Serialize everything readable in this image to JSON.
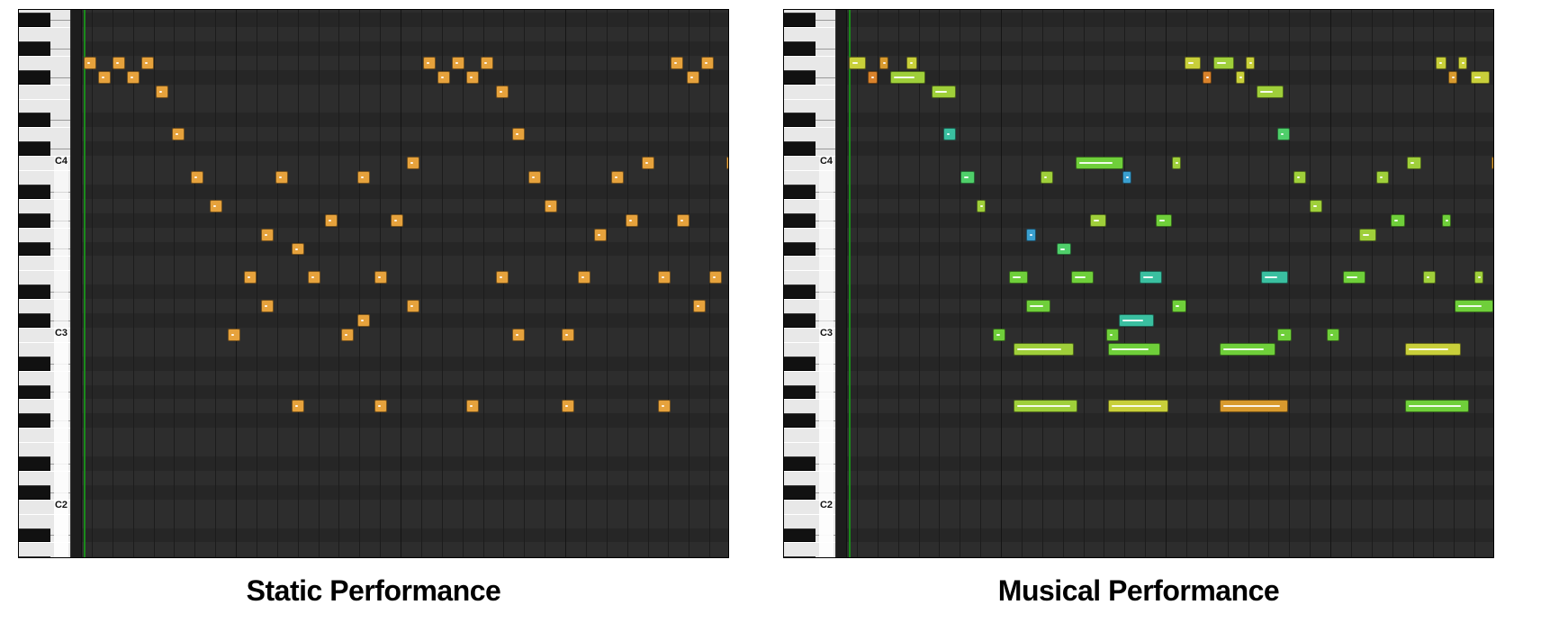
{
  "captions": {
    "left": "Static Performance",
    "right": "Musical Performance"
  },
  "keyLabels": {
    "C2": "C2",
    "C3": "C3",
    "C4": "C4"
  },
  "grid": {
    "rowHeight": 15.9,
    "topPitch": 70.2,
    "cols": 32,
    "playheadX": 14,
    "palette": {
      "0": "#e6a23c",
      "1": "#d9822b",
      "2": "#c8cf3a",
      "3": "#9fcf3a",
      "4": "#6fcf3a",
      "5": "#4fcf6a",
      "6": "#3abfa0",
      "7": "#3a9fcf",
      "8": "#d89a2e"
    }
  },
  "panels": [
    {
      "id": "static",
      "notes": [
        {
          "p": 67,
          "s": 0.0,
          "d": 0.7,
          "c": 0,
          "v": 0.3
        },
        {
          "p": 66,
          "s": 0.7,
          "d": 0.7,
          "c": 0,
          "v": 0.3
        },
        {
          "p": 67,
          "s": 1.4,
          "d": 0.7,
          "c": 0,
          "v": 0.3
        },
        {
          "p": 66,
          "s": 2.1,
          "d": 0.7,
          "c": 0,
          "v": 0.3
        },
        {
          "p": 67,
          "s": 2.8,
          "d": 0.7,
          "c": 0,
          "v": 0.3
        },
        {
          "p": 65,
          "s": 3.5,
          "d": 0.7,
          "c": 0,
          "v": 0.3
        },
        {
          "p": 62,
          "s": 4.3,
          "d": 0.7,
          "c": 0,
          "v": 0.3
        },
        {
          "p": 59,
          "s": 5.2,
          "d": 0.7,
          "c": 0,
          "v": 0.3
        },
        {
          "p": 57,
          "s": 6.1,
          "d": 0.7,
          "c": 0,
          "v": 0.3
        },
        {
          "p": 48,
          "s": 7.0,
          "d": 0.7,
          "c": 0,
          "v": 0.3
        },
        {
          "p": 52,
          "s": 7.8,
          "d": 0.7,
          "c": 0,
          "v": 0.3
        },
        {
          "p": 50,
          "s": 8.6,
          "d": 0.7,
          "c": 0,
          "v": 0.3
        },
        {
          "p": 55,
          "s": 8.6,
          "d": 0.7,
          "c": 0,
          "v": 0.3
        },
        {
          "p": 59,
          "s": 9.3,
          "d": 0.7,
          "c": 0,
          "v": 0.3
        },
        {
          "p": 54,
          "s": 10.1,
          "d": 0.7,
          "c": 0,
          "v": 0.3
        },
        {
          "p": 43,
          "s": 10.1,
          "d": 0.7,
          "c": 0,
          "v": 0.3
        },
        {
          "p": 52,
          "s": 10.9,
          "d": 0.7,
          "c": 0,
          "v": 0.3
        },
        {
          "p": 56,
          "s": 11.7,
          "d": 0.7,
          "c": 0,
          "v": 0.3
        },
        {
          "p": 48,
          "s": 12.5,
          "d": 0.7,
          "c": 0,
          "v": 0.3
        },
        {
          "p": 49,
          "s": 13.3,
          "d": 0.7,
          "c": 0,
          "v": 0.3
        },
        {
          "p": 59,
          "s": 13.3,
          "d": 0.7,
          "c": 0,
          "v": 0.3
        },
        {
          "p": 52,
          "s": 14.1,
          "d": 0.7,
          "c": 0,
          "v": 0.3
        },
        {
          "p": 43,
          "s": 14.1,
          "d": 0.7,
          "c": 0,
          "v": 0.3
        },
        {
          "p": 56,
          "s": 14.9,
          "d": 0.7,
          "c": 0,
          "v": 0.3
        },
        {
          "p": 50,
          "s": 15.7,
          "d": 0.7,
          "c": 0,
          "v": 0.3
        },
        {
          "p": 60,
          "s": 15.7,
          "d": 0.7,
          "c": 0,
          "v": 0.3
        },
        {
          "p": 67,
          "s": 16.5,
          "d": 0.7,
          "c": 0,
          "v": 0.3
        },
        {
          "p": 66,
          "s": 17.2,
          "d": 0.7,
          "c": 0,
          "v": 0.3
        },
        {
          "p": 67,
          "s": 17.9,
          "d": 0.7,
          "c": 0,
          "v": 0.3
        },
        {
          "p": 66,
          "s": 18.6,
          "d": 0.7,
          "c": 0,
          "v": 0.3
        },
        {
          "p": 67,
          "s": 19.3,
          "d": 0.7,
          "c": 0,
          "v": 0.3
        },
        {
          "p": 65,
          "s": 20.0,
          "d": 0.7,
          "c": 0,
          "v": 0.3
        },
        {
          "p": 43,
          "s": 18.6,
          "d": 0.7,
          "c": 0,
          "v": 0.3
        },
        {
          "p": 62,
          "s": 20.8,
          "d": 0.7,
          "c": 0,
          "v": 0.3
        },
        {
          "p": 52,
          "s": 20.0,
          "d": 0.7,
          "c": 0,
          "v": 0.3
        },
        {
          "p": 48,
          "s": 20.8,
          "d": 0.7,
          "c": 0,
          "v": 0.3
        },
        {
          "p": 59,
          "s": 21.6,
          "d": 0.7,
          "c": 0,
          "v": 0.3
        },
        {
          "p": 57,
          "s": 22.4,
          "d": 0.7,
          "c": 0,
          "v": 0.3
        },
        {
          "p": 48,
          "s": 23.2,
          "d": 0.7,
          "c": 0,
          "v": 0.3
        },
        {
          "p": 43,
          "s": 23.2,
          "d": 0.7,
          "c": 0,
          "v": 0.3
        },
        {
          "p": 52,
          "s": 24.0,
          "d": 0.7,
          "c": 0,
          "v": 0.3
        },
        {
          "p": 55,
          "s": 24.8,
          "d": 0.7,
          "c": 0,
          "v": 0.3
        },
        {
          "p": 59,
          "s": 25.6,
          "d": 0.7,
          "c": 0,
          "v": 0.3
        },
        {
          "p": 56,
          "s": 26.3,
          "d": 0.7,
          "c": 0,
          "v": 0.3
        },
        {
          "p": 60,
          "s": 27.1,
          "d": 0.7,
          "c": 0,
          "v": 0.3
        },
        {
          "p": 52,
          "s": 27.9,
          "d": 0.7,
          "c": 0,
          "v": 0.3
        },
        {
          "p": 43,
          "s": 27.9,
          "d": 0.7,
          "c": 0,
          "v": 0.3
        },
        {
          "p": 67,
          "s": 28.5,
          "d": 0.7,
          "c": 0,
          "v": 0.3
        },
        {
          "p": 56,
          "s": 28.8,
          "d": 0.7,
          "c": 0,
          "v": 0.3
        },
        {
          "p": 66,
          "s": 29.3,
          "d": 0.7,
          "c": 0,
          "v": 0.3
        },
        {
          "p": 50,
          "s": 29.6,
          "d": 0.7,
          "c": 0,
          "v": 0.3
        },
        {
          "p": 67,
          "s": 30.0,
          "d": 0.7,
          "c": 0,
          "v": 0.3
        },
        {
          "p": 52,
          "s": 30.4,
          "d": 0.7,
          "c": 0,
          "v": 0.3
        },
        {
          "p": 60,
          "s": 31.2,
          "d": 0.7,
          "c": 0,
          "v": 0.3
        }
      ]
    },
    {
      "id": "musical",
      "notes": [
        {
          "p": 67,
          "s": 0.0,
          "d": 0.9,
          "c": 2,
          "v": 0.5
        },
        {
          "p": 66,
          "s": 0.9,
          "d": 0.6,
          "c": 1,
          "v": 0.4
        },
        {
          "p": 67,
          "s": 1.5,
          "d": 0.5,
          "c": 8,
          "v": 0.3
        },
        {
          "p": 66,
          "s": 2.0,
          "d": 1.8,
          "c": 3,
          "v": 0.7
        },
        {
          "p": 67,
          "s": 2.8,
          "d": 0.6,
          "c": 2,
          "v": 0.4
        },
        {
          "p": 65,
          "s": 4.0,
          "d": 1.3,
          "c": 3,
          "v": 0.6
        },
        {
          "p": 62,
          "s": 4.6,
          "d": 0.7,
          "c": 6,
          "v": 0.4
        },
        {
          "p": 59,
          "s": 5.4,
          "d": 0.8,
          "c": 5,
          "v": 0.5
        },
        {
          "p": 57,
          "s": 6.2,
          "d": 0.5,
          "c": 3,
          "v": 0.3
        },
        {
          "p": 48,
          "s": 7.0,
          "d": 0.7,
          "c": 4,
          "v": 0.5
        },
        {
          "p": 52,
          "s": 7.8,
          "d": 1.0,
          "c": 4,
          "v": 0.6
        },
        {
          "p": 50,
          "s": 8.6,
          "d": 1.3,
          "c": 4,
          "v": 0.7
        },
        {
          "p": 55,
          "s": 8.6,
          "d": 0.6,
          "c": 7,
          "v": 0.3
        },
        {
          "p": 59,
          "s": 9.3,
          "d": 0.7,
          "c": 3,
          "v": 0.4
        },
        {
          "p": 43,
          "s": 8.0,
          "d": 3.2,
          "c": 3,
          "v": 0.9
        },
        {
          "p": 47,
          "s": 8.0,
          "d": 3.0,
          "c": 3,
          "v": 0.8
        },
        {
          "p": 54,
          "s": 10.1,
          "d": 0.8,
          "c": 5,
          "v": 0.5
        },
        {
          "p": 52,
          "s": 10.8,
          "d": 1.2,
          "c": 4,
          "v": 0.6
        },
        {
          "p": 56,
          "s": 11.7,
          "d": 0.9,
          "c": 3,
          "v": 0.5
        },
        {
          "p": 60,
          "s": 11.0,
          "d": 2.4,
          "c": 4,
          "v": 0.8
        },
        {
          "p": 48,
          "s": 12.5,
          "d": 0.7,
          "c": 4,
          "v": 0.4
        },
        {
          "p": 49,
          "s": 13.1,
          "d": 1.8,
          "c": 6,
          "v": 0.7
        },
        {
          "p": 59,
          "s": 13.3,
          "d": 0.5,
          "c": 7,
          "v": 0.2
        },
        {
          "p": 43,
          "s": 12.6,
          "d": 3.0,
          "c": 2,
          "v": 0.9
        },
        {
          "p": 47,
          "s": 12.6,
          "d": 2.6,
          "c": 4,
          "v": 0.8
        },
        {
          "p": 52,
          "s": 14.1,
          "d": 1.2,
          "c": 6,
          "v": 0.6
        },
        {
          "p": 56,
          "s": 14.9,
          "d": 0.9,
          "c": 4,
          "v": 0.5
        },
        {
          "p": 50,
          "s": 15.7,
          "d": 0.8,
          "c": 4,
          "v": 0.4
        },
        {
          "p": 60,
          "s": 15.7,
          "d": 0.5,
          "c": 3,
          "v": 0.3
        },
        {
          "p": 67,
          "s": 16.3,
          "d": 0.9,
          "c": 2,
          "v": 0.5
        },
        {
          "p": 66,
          "s": 17.2,
          "d": 0.5,
          "c": 1,
          "v": 0.3
        },
        {
          "p": 67,
          "s": 17.7,
          "d": 1.1,
          "c": 3,
          "v": 0.6
        },
        {
          "p": 66,
          "s": 18.8,
          "d": 0.5,
          "c": 2,
          "v": 0.3
        },
        {
          "p": 67,
          "s": 19.3,
          "d": 0.5,
          "c": 2,
          "v": 0.3
        },
        {
          "p": 65,
          "s": 19.8,
          "d": 1.4,
          "c": 3,
          "v": 0.6
        },
        {
          "p": 43,
          "s": 18.0,
          "d": 3.4,
          "c": 8,
          "v": 0.9
        },
        {
          "p": 47,
          "s": 18.0,
          "d": 2.8,
          "c": 4,
          "v": 0.8
        },
        {
          "p": 62,
          "s": 20.8,
          "d": 0.7,
          "c": 5,
          "v": 0.4
        },
        {
          "p": 52,
          "s": 20.0,
          "d": 1.4,
          "c": 6,
          "v": 0.6
        },
        {
          "p": 48,
          "s": 20.8,
          "d": 0.8,
          "c": 4,
          "v": 0.4
        },
        {
          "p": 59,
          "s": 21.6,
          "d": 0.7,
          "c": 3,
          "v": 0.4
        },
        {
          "p": 57,
          "s": 22.4,
          "d": 0.7,
          "c": 3,
          "v": 0.4
        },
        {
          "p": 48,
          "s": 23.2,
          "d": 0.7,
          "c": 4,
          "v": 0.4
        },
        {
          "p": 52,
          "s": 24.0,
          "d": 1.2,
          "c": 4,
          "v": 0.6
        },
        {
          "p": 55,
          "s": 24.8,
          "d": 0.9,
          "c": 3,
          "v": 0.5
        },
        {
          "p": 59,
          "s": 25.6,
          "d": 0.7,
          "c": 3,
          "v": 0.4
        },
        {
          "p": 56,
          "s": 26.3,
          "d": 0.8,
          "c": 4,
          "v": 0.4
        },
        {
          "p": 60,
          "s": 27.1,
          "d": 0.8,
          "c": 3,
          "v": 0.4
        },
        {
          "p": 52,
          "s": 27.9,
          "d": 0.7,
          "c": 3,
          "v": 0.4
        },
        {
          "p": 43,
          "s": 27.0,
          "d": 3.2,
          "c": 4,
          "v": 0.9
        },
        {
          "p": 47,
          "s": 27.0,
          "d": 2.8,
          "c": 2,
          "v": 0.8
        },
        {
          "p": 67,
          "s": 28.5,
          "d": 0.6,
          "c": 2,
          "v": 0.4
        },
        {
          "p": 56,
          "s": 28.8,
          "d": 0.5,
          "c": 4,
          "v": 0.3
        },
        {
          "p": 66,
          "s": 29.1,
          "d": 0.5,
          "c": 8,
          "v": 0.3
        },
        {
          "p": 50,
          "s": 29.4,
          "d": 2.0,
          "c": 4,
          "v": 0.7
        },
        {
          "p": 67,
          "s": 29.6,
          "d": 0.5,
          "c": 2,
          "v": 0.3
        },
        {
          "p": 66,
          "s": 30.2,
          "d": 1.0,
          "c": 2,
          "v": 0.5
        },
        {
          "p": 52,
          "s": 30.4,
          "d": 0.4,
          "c": 3,
          "v": 0.2
        },
        {
          "p": 60,
          "s": 31.2,
          "d": 0.7,
          "c": 8,
          "v": 0.4
        }
      ]
    }
  ]
}
